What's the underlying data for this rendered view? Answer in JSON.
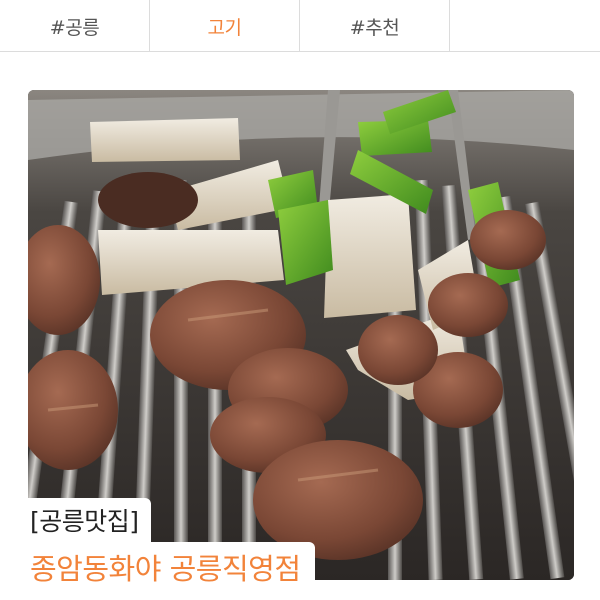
{
  "tabs": [
    {
      "label": "#공릉",
      "active": false
    },
    {
      "label": "고기",
      "active": true
    },
    {
      "label": "#추천",
      "active": false
    },
    {
      "label": "",
      "active": false
    }
  ],
  "card": {
    "image_alt": "grilled beef with mushrooms and green peppers on a grill",
    "tag": "[공릉맛집]",
    "title": "종암동화야 공릉직영점"
  },
  "colors": {
    "accent": "#f2833a",
    "text": "#222222",
    "divider": "#dcdcdc"
  }
}
